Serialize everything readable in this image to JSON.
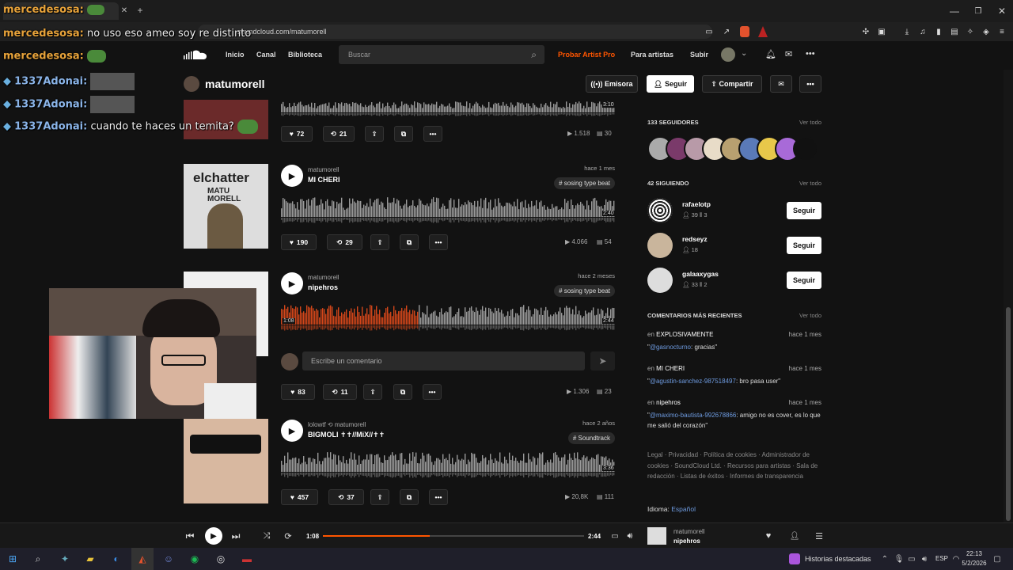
{
  "browser": {
    "tab_title": "mercedesosa: no uso eso ameo soy re distinto",
    "url": "soundcloud.com/matumorell"
  },
  "nav": {
    "inicio": "Inicio",
    "canal": "Canal",
    "biblioteca": "Biblioteca",
    "search_placeholder": "Buscar",
    "pro": "Probar Artist Pro",
    "artists": "Para artistas",
    "upload": "Subir"
  },
  "profile": {
    "name": "matumorell",
    "emisora": "Emisora",
    "seguir": "Seguir",
    "compartir": "Compartir"
  },
  "tracks": [
    {
      "likes": "72",
      "reposts": "21",
      "plays": "1.518",
      "comments": "30",
      "duration": "3:10"
    },
    {
      "user": "matumorell",
      "title": "MI CHERI",
      "ago": "hace 1 mes",
      "tag": "# sosing type beat",
      "likes": "190",
      "reposts": "29",
      "plays": "4.066",
      "comments": "54",
      "duration": "2:40",
      "cover_text": "elchatter",
      "cover_sub": "MATU MORELL"
    },
    {
      "user": "matumorell",
      "title": "nipehros",
      "ago": "hace 2 meses",
      "tag": "# sosing type beat",
      "likes": "83",
      "reposts": "11",
      "plays": "1.306",
      "comments": "23",
      "elapsed": "1:08",
      "duration": "2:44",
      "comment_placeholder": "Escribe un comentario",
      "progress": 0.41
    },
    {
      "user": "lolowtf",
      "repost_user": "matumorell",
      "title": "BIGMOLI ✝✝//MiX//✝✝",
      "ago": "hace 2 años",
      "tag": "# Soundtrack",
      "likes": "457",
      "reposts": "37",
      "plays": "20,8K",
      "comments": "111",
      "duration": "3:36"
    }
  ],
  "sidebar": {
    "followers_label": "133 SEGUIDORES",
    "following_label": "42 SIGUIENDO",
    "ver_todo": "Ver todo",
    "following": [
      {
        "name": "rafaelotp",
        "followers": "39",
        "tracks": "3",
        "button": "Seguir"
      },
      {
        "name": "redseyz",
        "followers": "18",
        "tracks": "",
        "button": "Seguir"
      },
      {
        "name": "galaaxygas",
        "followers": "33",
        "tracks": "2",
        "button": "Seguir"
      }
    ],
    "comments_label": "COMENTARIOS MÁS RECIENTES",
    "comments": [
      {
        "en": "en",
        "track": "EXPLOSIVAMENTE",
        "ago": "hace 1 mes",
        "mention": "@gasnocturno",
        "text": ": gracias\""
      },
      {
        "en": "en",
        "track": "MI CHERI",
        "ago": "hace 1 mes",
        "mention": "@agustin-sanchez-987518497",
        "text": ": bro pasa user\""
      },
      {
        "en": "en",
        "track": "nipehros",
        "ago": "hace 1 mes",
        "mention": "@maximo-bautista-992678866",
        "text": ": amigo no es cover, es lo que me salió del corazón\""
      }
    ],
    "footer": "Legal · Privacidad · Política de cookies · Administrador de cookies · SoundCloud Ltd. · Recursos para artistas · Sala de redacción · Listas de éxitos · Informes de transparencia",
    "idioma_label": "Idioma:",
    "idioma": "Español"
  },
  "player": {
    "elapsed": "1:08",
    "duration": "2:44",
    "artist": "matumorell",
    "title": "nipehros",
    "progress": 0.41
  },
  "chat": [
    {
      "user": "mercedesosa:",
      "msg": "no uso eso ameo soy re distinto",
      "color": "#e8a33a"
    },
    {
      "user": "mercedesosa:",
      "msg": "",
      "color": "#e8a33a"
    },
    {
      "user": "1337Adonai:",
      "msg": "",
      "color": "#8ab4e8"
    },
    {
      "user": "1337Adonai:",
      "msg": "",
      "color": "#8ab4e8"
    },
    {
      "user": "1337Adonai:",
      "msg": "cuando te haces un temita?",
      "color": "#8ab4e8"
    }
  ],
  "chat_top_user": "mercedesosa:",
  "taskbar": {
    "news": "Historias destacadas",
    "lang": "ESP",
    "time": "22:13",
    "date": "5/2/2026"
  }
}
